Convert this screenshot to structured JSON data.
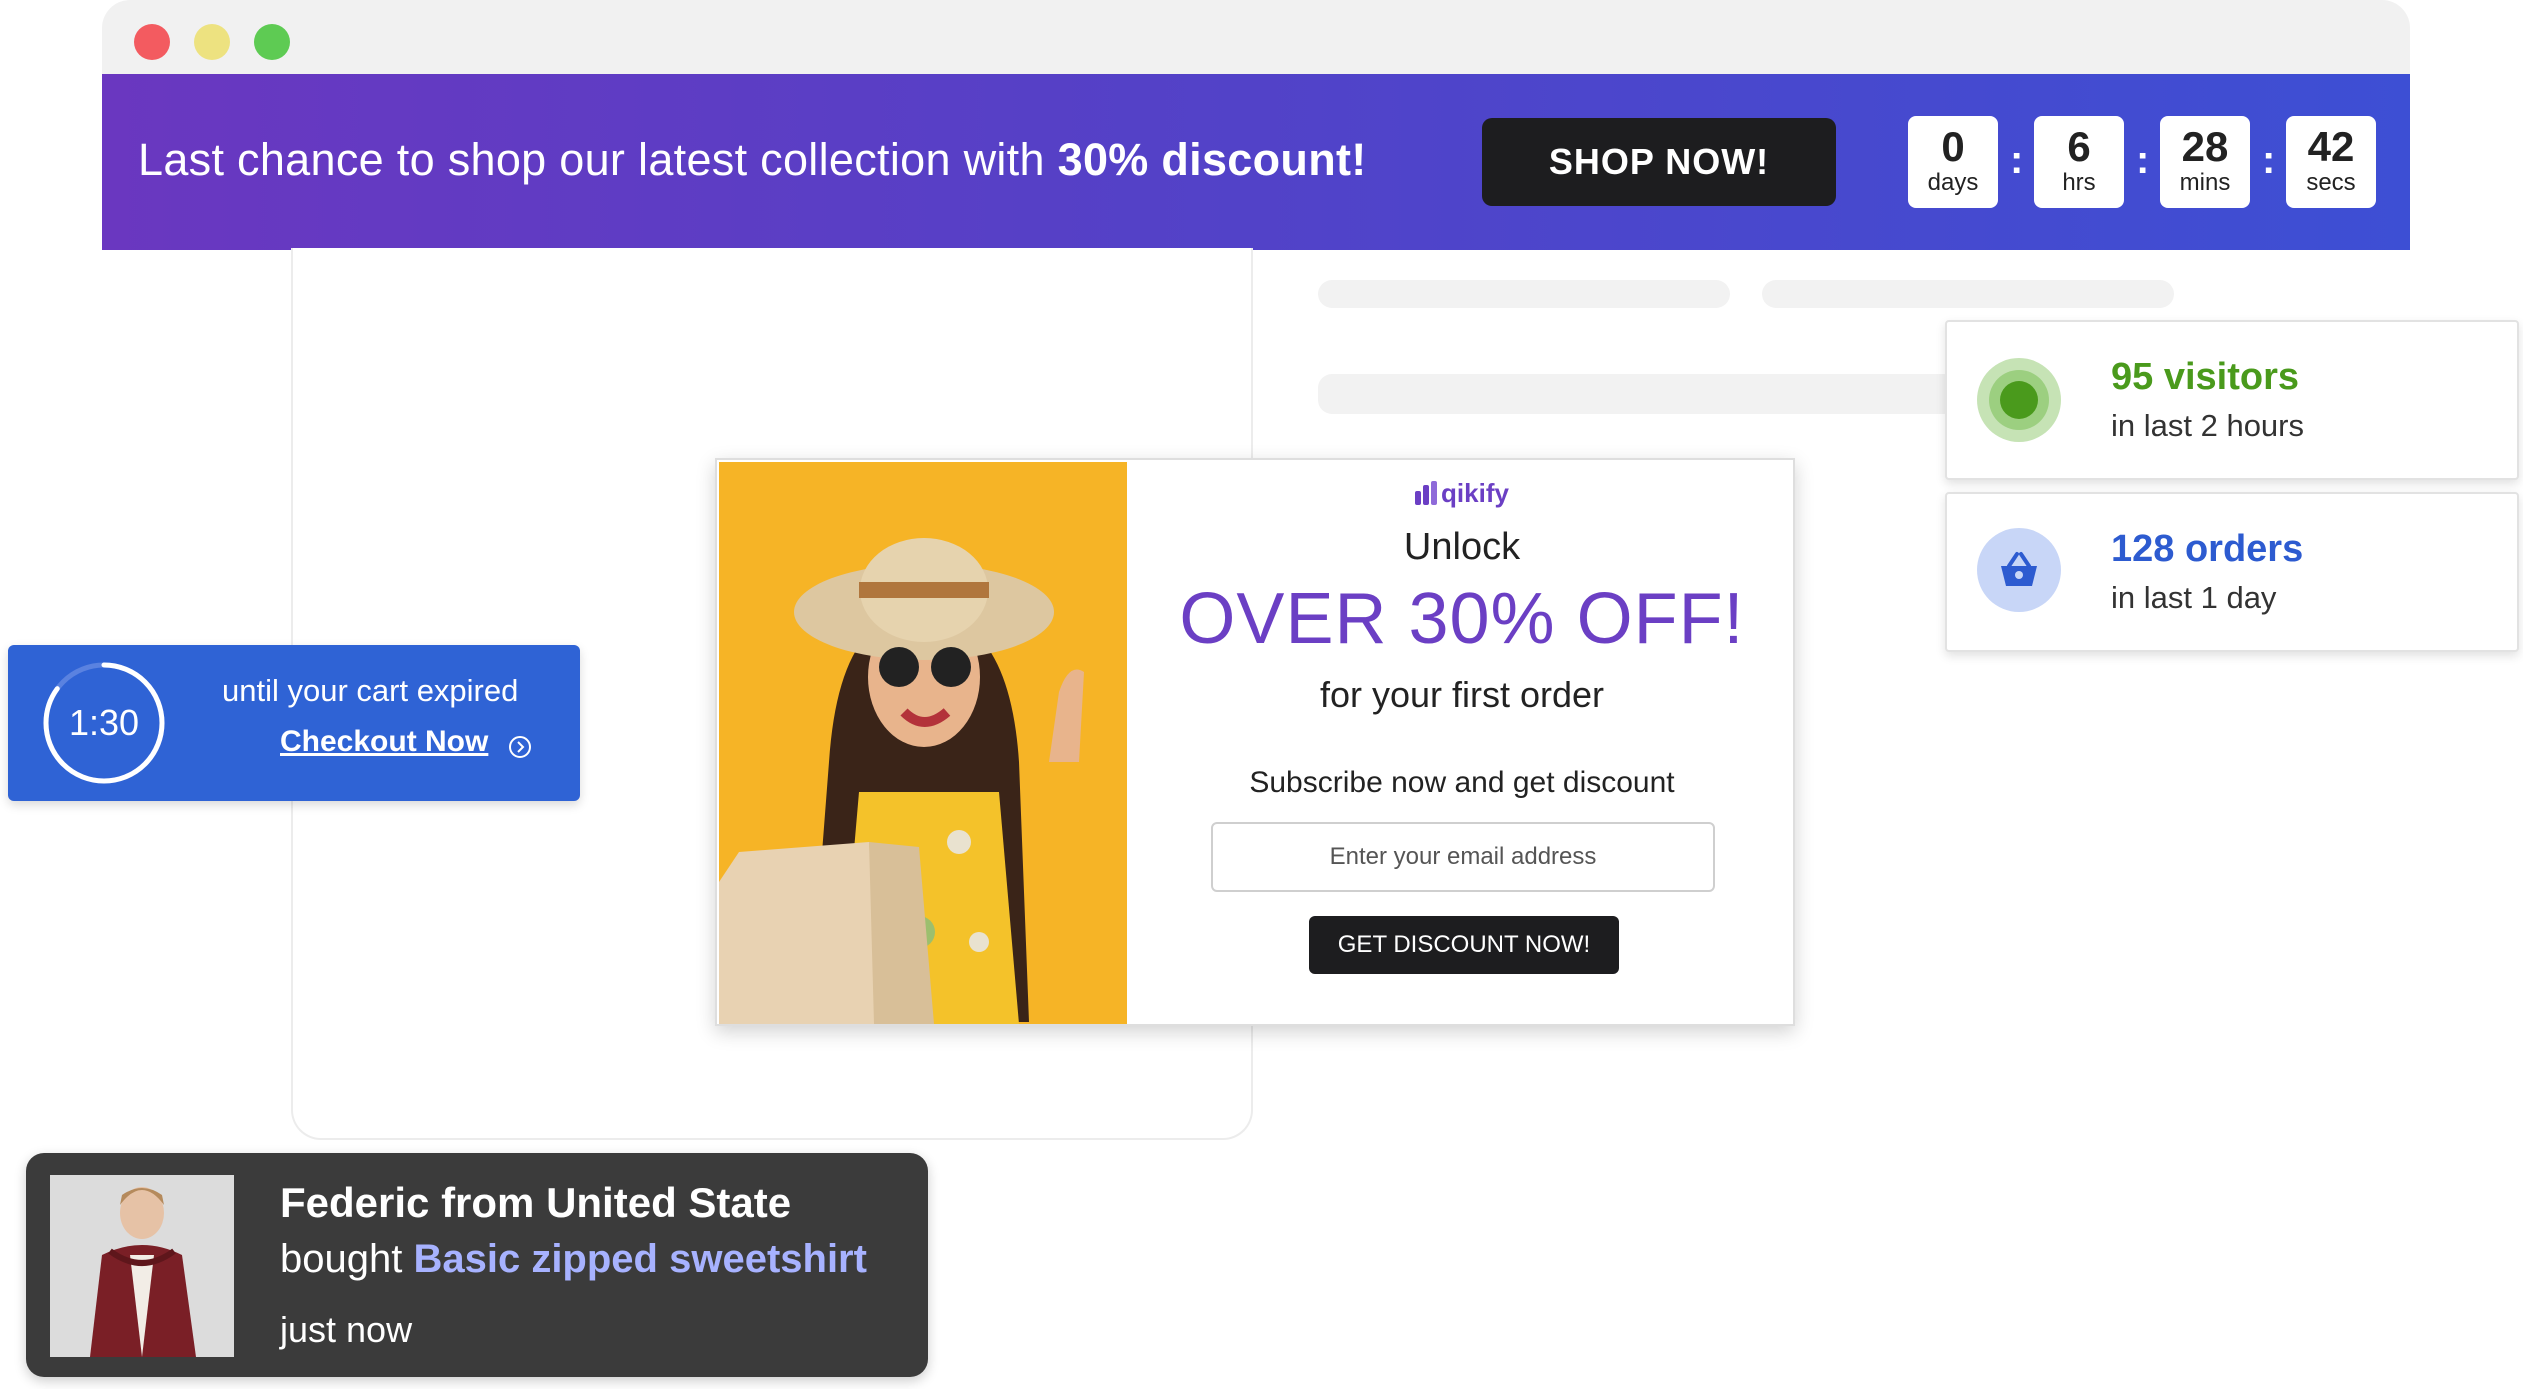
{
  "banner": {
    "text_prefix": "Last chance to shop our latest collection with ",
    "text_highlight": "30% discount!",
    "cta_label": "SHOP NOW!",
    "countdown": [
      {
        "value": "0",
        "unit": "days"
      },
      {
        "value": "6",
        "unit": "hrs"
      },
      {
        "value": "28",
        "unit": "mins"
      },
      {
        "value": "42",
        "unit": "secs"
      }
    ],
    "separator": ":"
  },
  "stats": {
    "visitors": {
      "title": "95 visitors",
      "subtitle": "in last 2 hours",
      "color": "#4a9a1c"
    },
    "orders": {
      "title": "128 orders",
      "subtitle": "in last 1 day",
      "color": "#2d5bd0"
    }
  },
  "popup": {
    "brand": "qikify",
    "unlock": "Unlock",
    "offer": "OVER 30% OFF!",
    "subtitle": "for your first order",
    "subscribe_text": "Subscribe now and get discount",
    "email_placeholder": "Enter your email address",
    "button_label": "GET DISCOUNT NOW!"
  },
  "cart_timer": {
    "time": "1:30",
    "text": "until your cart expired",
    "link_label": "Checkout Now",
    "progress_remaining": 0.85
  },
  "purchase": {
    "name": "Federic from United State",
    "bought_prefix": "bought ",
    "product": "Basic zipped sweetshirt",
    "time": "just now"
  },
  "colors": {
    "brand_purple": "#6b3fc4",
    "cart_blue": "#2f63d5"
  }
}
